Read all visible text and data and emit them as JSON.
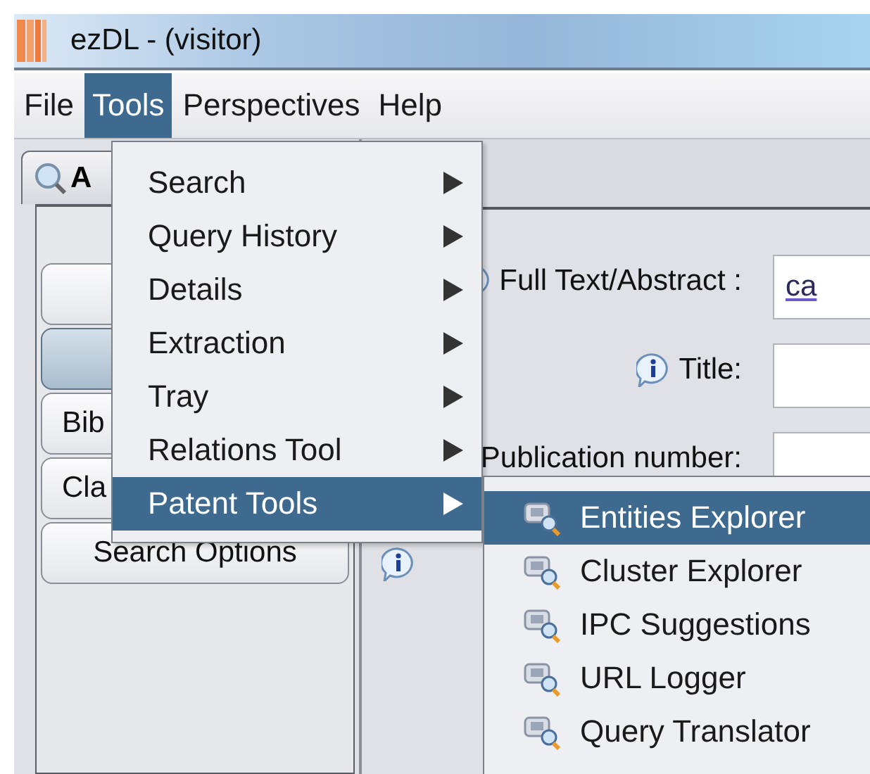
{
  "window": {
    "title": "ezDL - (visitor)"
  },
  "menu_bar": [
    {
      "label": "File",
      "selected": false
    },
    {
      "label": "Tools",
      "selected": true
    },
    {
      "label": "Perspectives",
      "selected": false
    },
    {
      "label": "Help",
      "selected": false
    }
  ],
  "tools_menu": [
    {
      "label": "Search",
      "selected": false
    },
    {
      "label": "Query History",
      "selected": false
    },
    {
      "label": "Details",
      "selected": false
    },
    {
      "label": "Extraction",
      "selected": false
    },
    {
      "label": "Tray",
      "selected": false
    },
    {
      "label": "Relations Tool",
      "selected": false
    },
    {
      "label": "Patent Tools",
      "selected": true
    }
  ],
  "patent_tools_menu": [
    {
      "label": "Entities Explorer",
      "selected": true
    },
    {
      "label": "Cluster Explorer",
      "selected": false
    },
    {
      "label": "IPC Suggestions",
      "selected": false
    },
    {
      "label": "URL Logger",
      "selected": false
    },
    {
      "label": "Query Translator",
      "selected": false
    }
  ],
  "side_tab": {
    "label": "A"
  },
  "side_buttons": [
    {
      "selected": false
    },
    {
      "selected": true
    },
    {
      "label": "Bib",
      "selected": false
    },
    {
      "label": "Cla",
      "selected": false
    },
    {
      "label": "Search Options",
      "selected": false
    }
  ],
  "form": [
    {
      "label": "Full Text/Abstract :",
      "value": "ca",
      "info": true
    },
    {
      "label": "Title:",
      "info": true
    },
    {
      "label": "Publication number:",
      "info": false
    },
    {
      "info": true
    }
  ]
}
